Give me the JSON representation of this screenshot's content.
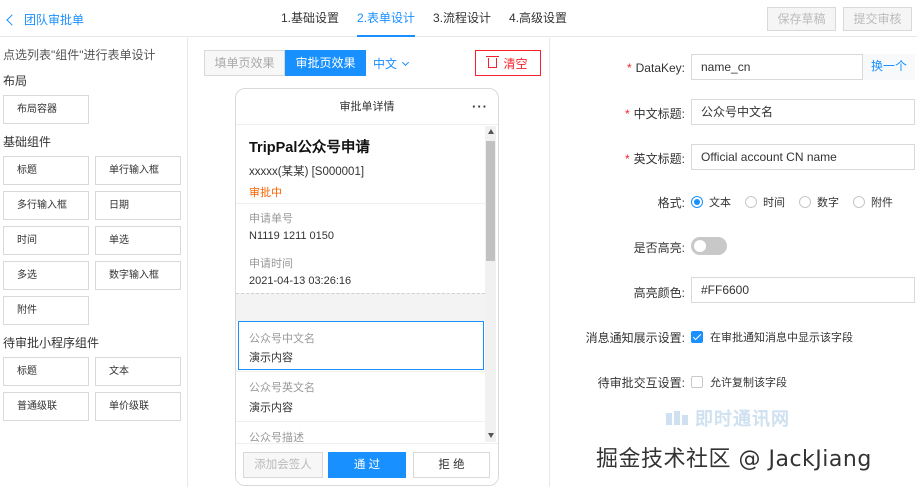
{
  "header": {
    "back_label": "团队审批单",
    "steps": [
      {
        "label": "1.基础设置"
      },
      {
        "label": "2.表单设计"
      },
      {
        "label": "3.流程设计"
      },
      {
        "label": "4.高级设置"
      }
    ],
    "active_step": 1,
    "save_draft_label": "保存草稿",
    "submit_label": "提交审核"
  },
  "palette": {
    "hint": "点选列表\"组件\"进行表单设计",
    "groups": [
      {
        "title": "布局",
        "items": [
          "布局容器"
        ]
      },
      {
        "title": "基础组件",
        "items": [
          "标题",
          "单行输入框",
          "多行输入框",
          "日期",
          "时间",
          "单选",
          "多选",
          "数字输入框",
          "附件"
        ]
      },
      {
        "title": "待审批小程序组件",
        "items": [
          "标题",
          "文本",
          "普通级联",
          "单价级联"
        ]
      }
    ]
  },
  "canvas": {
    "view_tabs": [
      "填单页效果",
      "审批页效果"
    ],
    "active_view": 1,
    "language": "中文",
    "clear_label": "清空",
    "phone": {
      "header_title": "审批单详情",
      "more_glyph": "···",
      "form_title": "TripPal公众号申请",
      "applicant": "xxxxx(某某) [S000001]",
      "status": "审批中",
      "fields_static": [
        {
          "label": "申请单号",
          "value": "N1119 1211 0150"
        },
        {
          "label": "申请时间",
          "value": "2021-04-13 03:26:16"
        }
      ],
      "fields_design": [
        {
          "label": "公众号中文名",
          "value": "演示内容"
        },
        {
          "label": "公众号英文名",
          "value": "演示内容"
        },
        {
          "label": "公众号描述",
          "value": ""
        }
      ],
      "footer": {
        "add_signer": "添加会签人",
        "approve": "通 过",
        "reject": "拒 绝"
      }
    }
  },
  "properties": {
    "datakey": {
      "label": "DataKey:",
      "value": "name_cn",
      "swap_label": "换一个"
    },
    "cn_title": {
      "label": "中文标题:",
      "value": "公众号中文名"
    },
    "en_title": {
      "label": "英文标题:",
      "value": "Official account CN name"
    },
    "format": {
      "label": "格式:",
      "options": [
        "文本",
        "时间",
        "数字",
        "附件"
      ],
      "selected": "文本"
    },
    "highlight": {
      "label": "是否高亮:",
      "on": false
    },
    "highlight_color": {
      "label": "高亮颜色:",
      "value": "#FF6600"
    },
    "notify": {
      "label": "消息通知展示设置:",
      "checkbox_label": "在审批通知消息中显示该字段",
      "checked": true
    },
    "interaction": {
      "label": "待审批交互设置:",
      "checkbox_label": "允许复制该字段",
      "checked": false
    }
  },
  "watermark": {
    "logo_text": "即时通讯网",
    "credit": "掘金技术社区 @ JackJiang"
  },
  "colors": {
    "accent": "#1890ff",
    "danger": "#f5222d",
    "status_orange": "#fa6400"
  }
}
